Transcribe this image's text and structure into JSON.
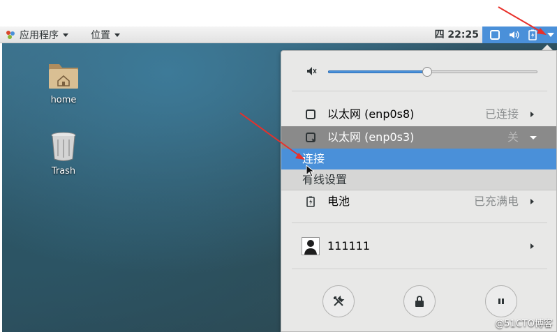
{
  "topbar": {
    "apps_menu": "应用程序",
    "places_menu": "位置",
    "clock": "四 22:25"
  },
  "desktop": {
    "icons": [
      {
        "label": "home"
      },
      {
        "label": "Trash"
      }
    ]
  },
  "system_menu": {
    "volume_level": 0.47,
    "network": [
      {
        "label": "以太网 (enp0s8)",
        "status": "已连接"
      },
      {
        "label": "以太网 (enp0s3)",
        "status": "关"
      }
    ],
    "submenu": {
      "connect": "连接",
      "wired_settings": "有线设置"
    },
    "battery": {
      "label": "电池",
      "status": "已充满电"
    },
    "user": {
      "name": "111111"
    },
    "actions": [
      "settings-icon",
      "lock-icon",
      "pause-icon"
    ]
  },
  "watermark": "@51CTO博客",
  "colors": {
    "accent": "#4a90d9",
    "annotation": "#e8302a",
    "active_row": "#8a8a8a"
  }
}
